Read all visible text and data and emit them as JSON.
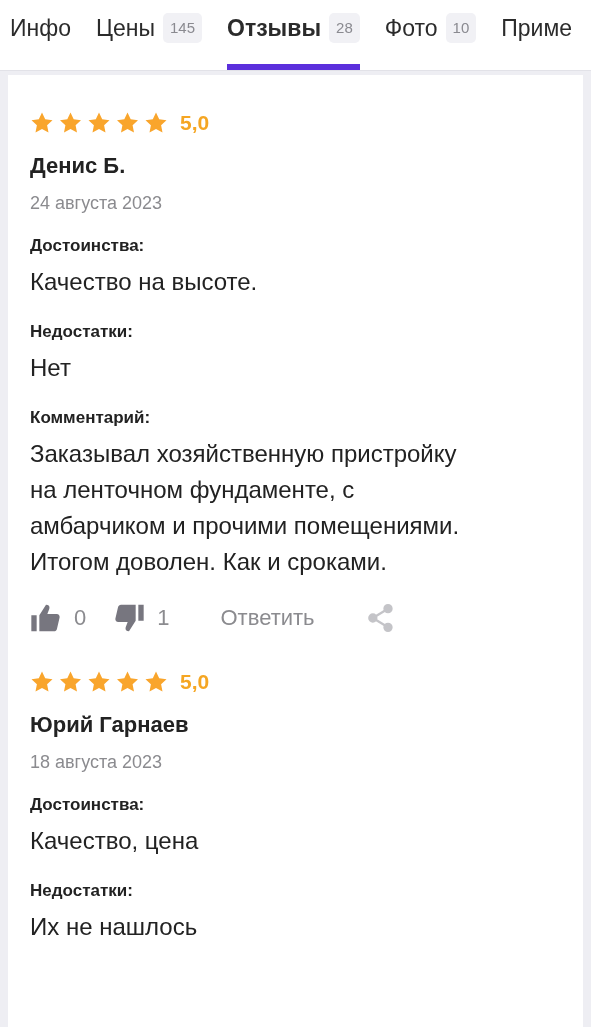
{
  "tabs": [
    {
      "label": "Инфо",
      "selected": false
    },
    {
      "label": "Цены",
      "count": "145",
      "selected": false
    },
    {
      "label": "Отзывы",
      "count": "28",
      "selected": true
    },
    {
      "label": "Фото",
      "count": "10",
      "selected": false
    },
    {
      "label": "Приме",
      "selected": false
    }
  ],
  "reviews": [
    {
      "stars": 5,
      "rating": "5,0",
      "author": "Денис Б.",
      "date": "24 августа 2023",
      "sections": [
        {
          "label": "Достоинства:",
          "text": "Качество на высоте."
        },
        {
          "label": "Недостатки:",
          "text": "Нет"
        },
        {
          "label": "Комментарий:",
          "text": "Заказывал хозяйственную пристройку на ленточном фундаменте, с амбарчиком и прочими помещениями. Итогом доволен. Как и сроками."
        }
      ],
      "likes": "0",
      "dislikes": "1",
      "reply": "Ответить"
    },
    {
      "stars": 5,
      "rating": "5,0",
      "author": "Юрий Гарнаев",
      "date": "18 августа 2023",
      "sections": [
        {
          "label": "Достоинства:",
          "text": "Качество, цена"
        },
        {
          "label": "Недостатки:",
          "text": "Их не нашлось"
        }
      ]
    }
  ]
}
